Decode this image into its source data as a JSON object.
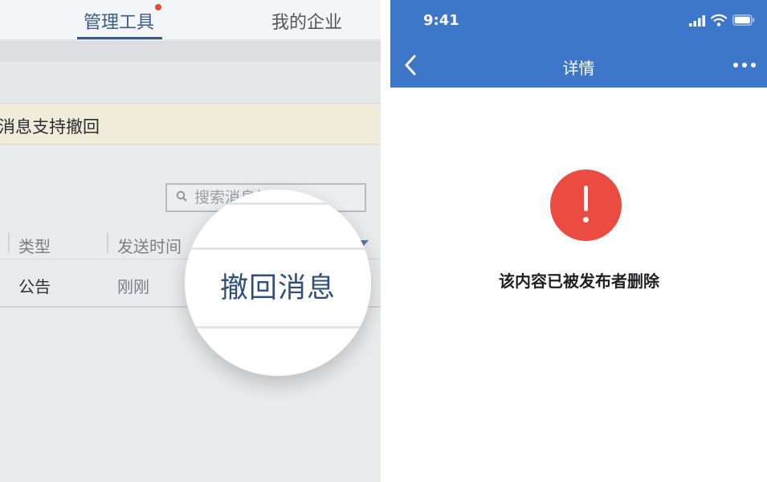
{
  "admin": {
    "tabs": [
      {
        "label": "管理工具"
      },
      {
        "label": "我的企业"
      }
    ],
    "notice": "消息支持撤回",
    "search": {
      "placeholder": "搜索消息标题"
    },
    "table": {
      "columns": [
        "类型",
        "发送时间"
      ],
      "rows": [
        {
          "type": "公告",
          "time": "刚刚"
        }
      ]
    },
    "magnifier": {
      "action_label": "撤回消息"
    }
  },
  "mobile": {
    "status_time": "9:41",
    "title": "详情",
    "deleted_message": "该内容已被发布者删除"
  },
  "colors": {
    "accent": "#3c5a86",
    "nav_bar": "#3e76c9",
    "alert": "#ec4b41",
    "notice_bg": "#f1ecd9"
  },
  "icons": [
    "search-icon",
    "sort-down-icon",
    "back-icon",
    "more-icon",
    "signal-icon",
    "wifi-icon",
    "battery-icon",
    "alert-icon"
  ]
}
